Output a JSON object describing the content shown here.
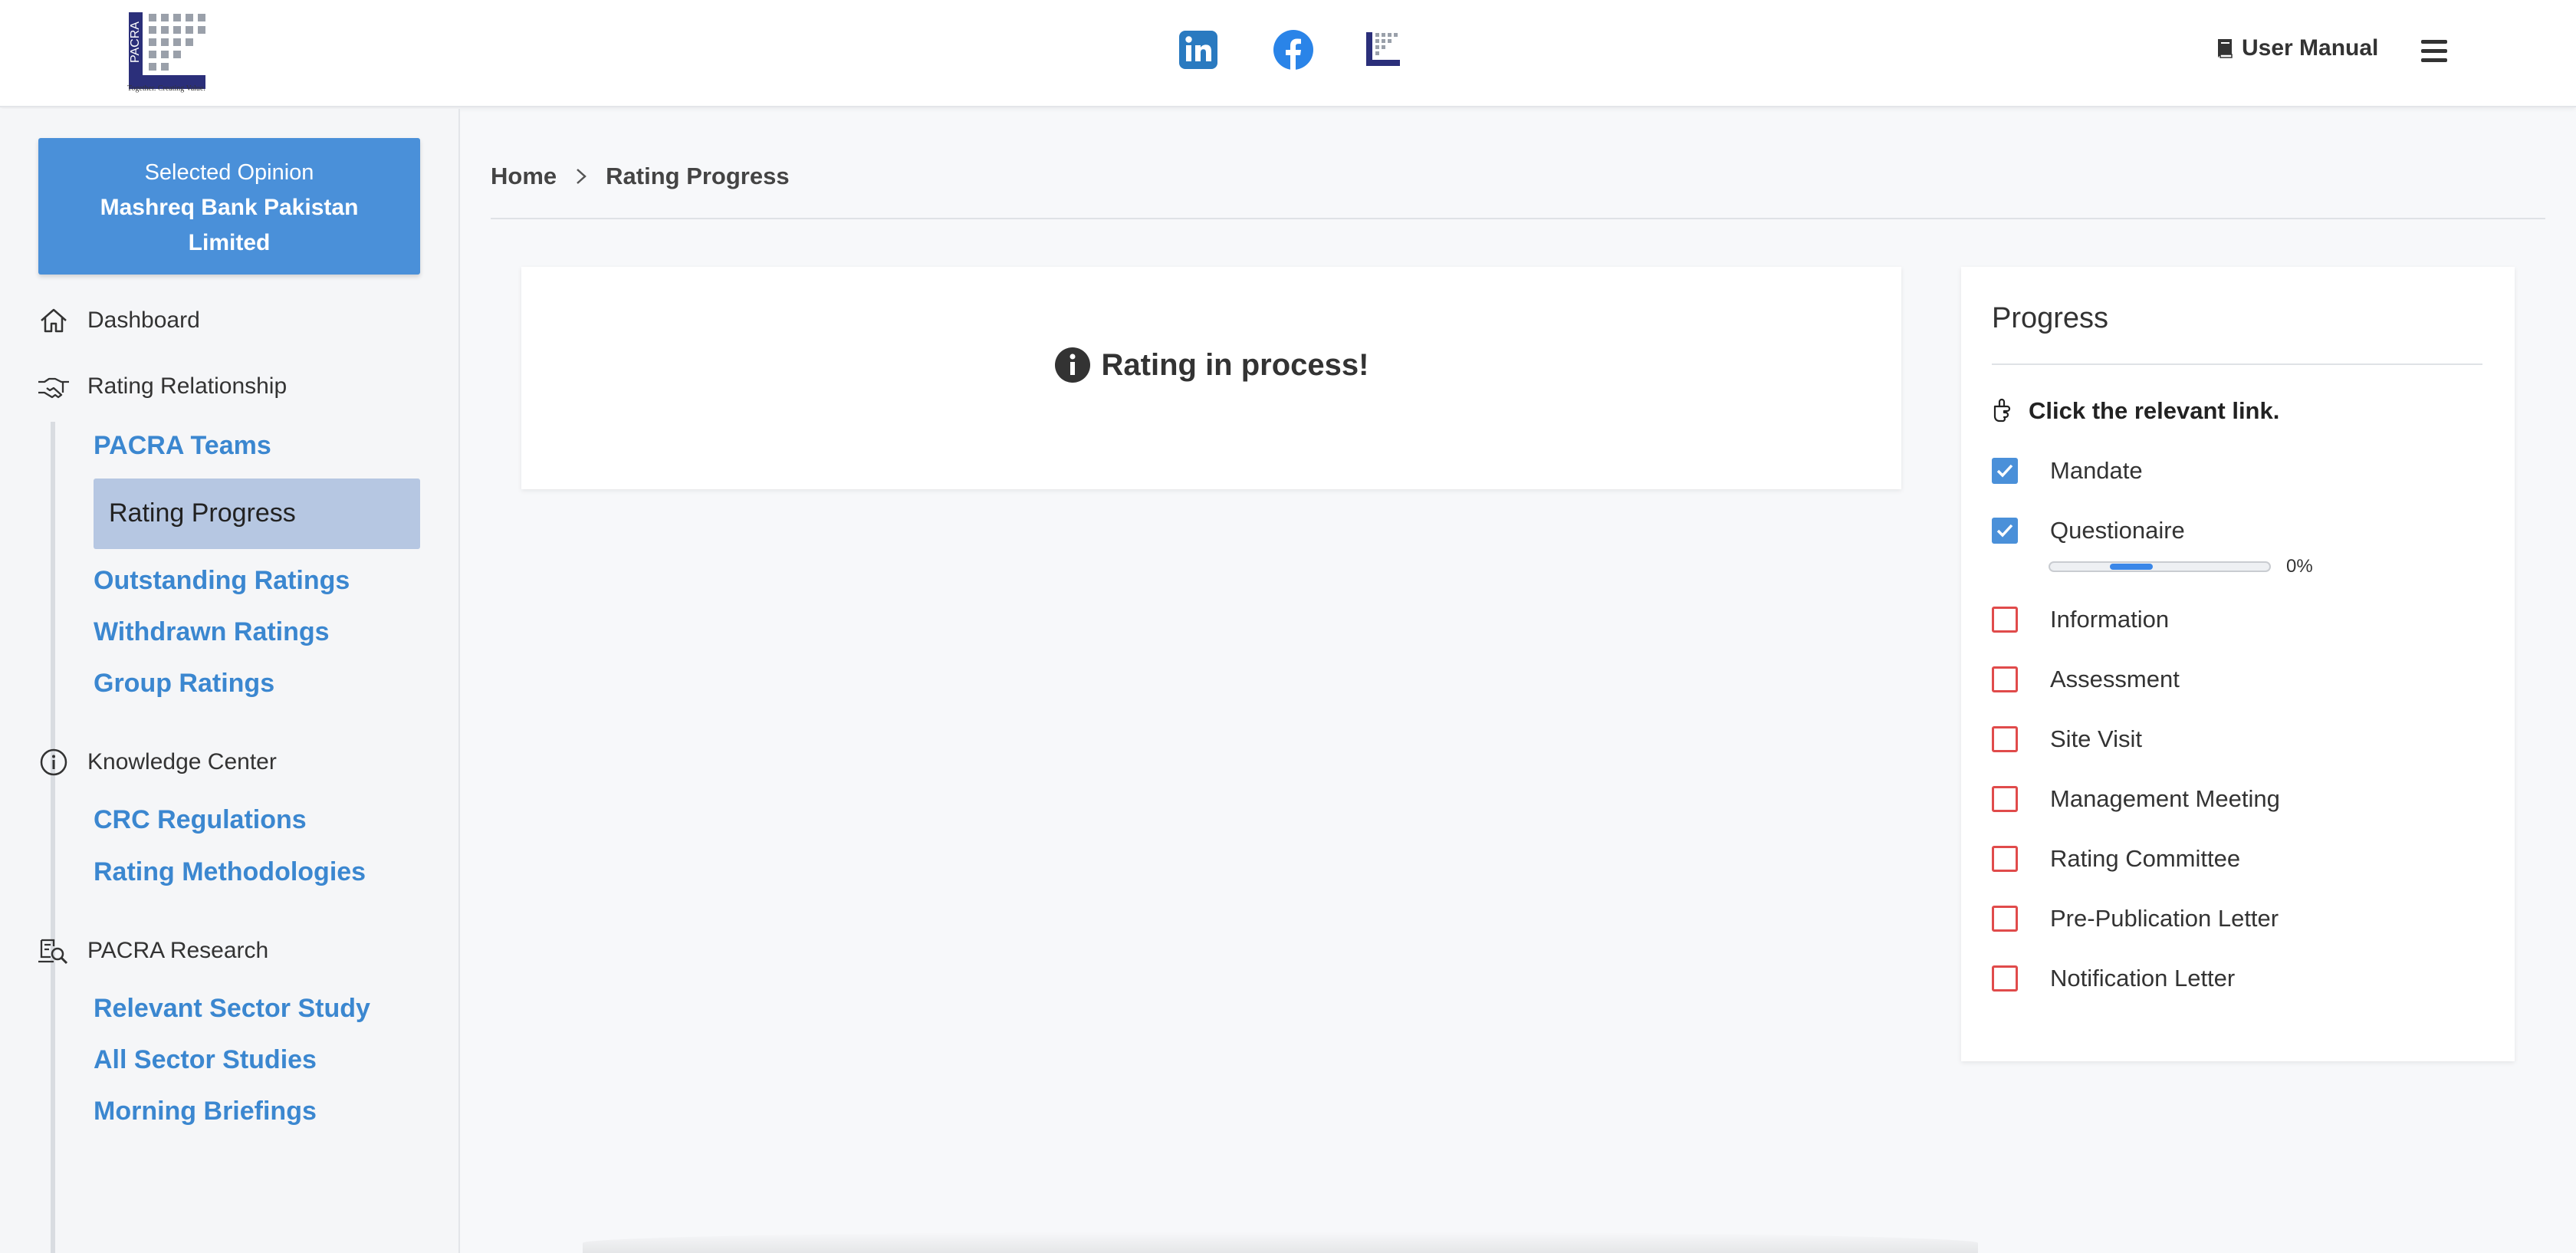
{
  "header": {
    "logo_text": "PACRA",
    "logo_tagline": "Together. Creating Value.",
    "user_manual_label": "User Manual",
    "icons": [
      "linkedin-icon",
      "facebook-icon",
      "pacra-icon",
      "book-icon",
      "hamburger-menu-icon"
    ],
    "colors": {
      "linkedin": "#2a7ac0",
      "facebook": "#2a84e8",
      "logo_navy": "#2b2f7a"
    }
  },
  "sidebar": {
    "selected_label": "Selected Opinion",
    "selected_name": "Mashreq Bank Pakistan Limited",
    "sections": [
      {
        "title": "Dashboard",
        "icon": "home-icon"
      },
      {
        "title": "Rating Relationship",
        "icon": "handshake-icon",
        "items": [
          "PACRA Teams",
          "Rating Progress",
          "Outstanding Ratings",
          "Withdrawn Ratings",
          "Group Ratings"
        ]
      },
      {
        "title": "Knowledge Center",
        "icon": "info-icon",
        "items": [
          "CRC Regulations",
          "Rating Methodologies"
        ]
      },
      {
        "title": "PACRA Research",
        "icon": "research-icon",
        "items": [
          "Relevant Sector Study",
          "All Sector Studies",
          "Morning Briefings"
        ]
      }
    ],
    "active_item": "Rating Progress",
    "colors": {
      "selected_bg": "#4a90d9",
      "link": "#3b87d0",
      "active_bg": "#b6c7e2"
    }
  },
  "breadcrumb": {
    "home": "Home",
    "current": "Rating Progress"
  },
  "main": {
    "message": "Rating in process!"
  },
  "progress": {
    "title": "Progress",
    "hint": "Click the relevant link.",
    "steps": [
      {
        "label": "Mandate",
        "checked": true
      },
      {
        "label": "Questionaire",
        "checked": true
      },
      {
        "label": "Information",
        "checked": false
      },
      {
        "label": "Assessment",
        "checked": false
      },
      {
        "label": "Site Visit",
        "checked": false
      },
      {
        "label": "Management Meeting",
        "checked": false
      },
      {
        "label": "Rating Committee",
        "checked": false
      },
      {
        "label": "Pre-Publication Letter",
        "checked": false
      },
      {
        "label": "Notification Letter",
        "checked": false
      }
    ],
    "questionaire_progress_text": "0%",
    "colors": {
      "checked": "#4a90d9",
      "unchecked_border": "#e04b4b",
      "bar": "#3b87e8"
    }
  }
}
